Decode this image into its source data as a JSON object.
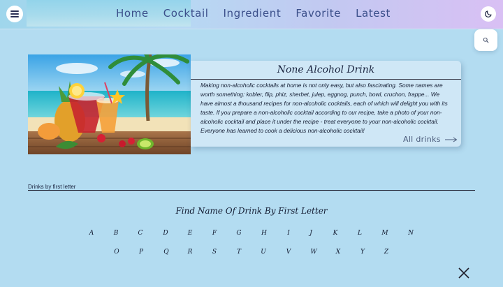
{
  "header": {
    "menu_icon": "hamburger-menu-icon",
    "nav": [
      "Home",
      "Cocktail",
      "Ingredient",
      "Favorite",
      "Latest"
    ],
    "theme_icon": "moon-icon",
    "search_icon": "search-icon"
  },
  "hero": {
    "title": "None Alcohol Drink",
    "description": "Making non-alcoholic cocktails at home is not only easy, but also fascinating. Some names are worth something: kobler, flip, phiz, sherbet, julep, eggnog, punch, bowl, cruchon, frappe... We have almost a thousand recipes for non-alcoholic cocktails, each of which will delight you with its taste. If you prepare a non-alcoholic cocktail according to our recipe, take a photo of your non-alcoholic cocktail and place it under the recipe - treat everyone to your non-alcoholic cocktail. Everyone has learned to cook a delicious non-alcoholic cocktail!",
    "link_label": "All drinks",
    "link_icon": "arrow-right-icon"
  },
  "letters_section": {
    "label": "Drinks by first letter",
    "title": "Find Name Of Drink By First Letter",
    "row1": [
      "A",
      "B",
      "C",
      "D",
      "E",
      "F",
      "G",
      "H",
      "I",
      "J",
      "K",
      "L",
      "M",
      "N"
    ],
    "row2": [
      "O",
      "P",
      "Q",
      "R",
      "S",
      "T",
      "U",
      "V",
      "W",
      "X",
      "Y",
      "Z"
    ]
  },
  "close_icon": "close-icon"
}
